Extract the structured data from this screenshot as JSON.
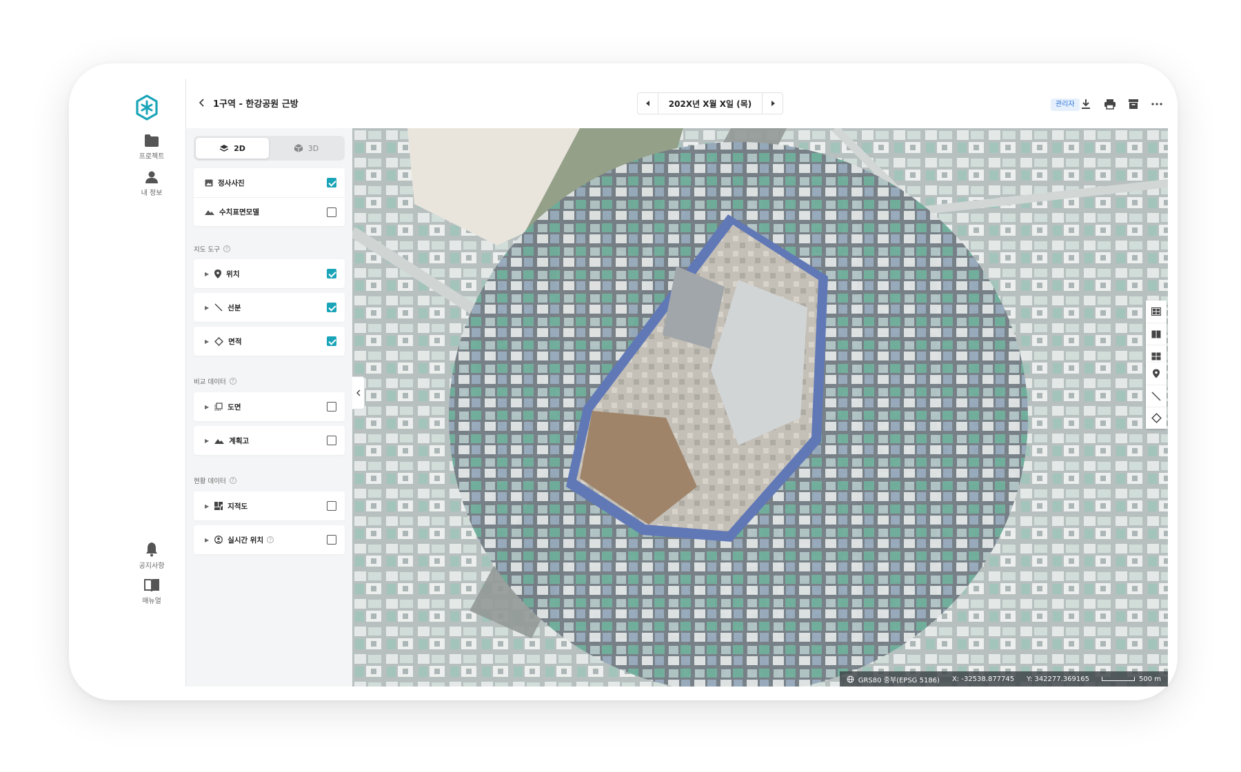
{
  "app": {
    "accent": "#1aa4b8"
  },
  "rail": {
    "items": [
      {
        "label": "프로젝트",
        "icon": "folder-icon"
      },
      {
        "label": "내 정보",
        "icon": "user-icon"
      }
    ],
    "bottom": [
      {
        "label": "공지사항",
        "icon": "bell-icon"
      },
      {
        "label": "매뉴얼",
        "icon": "book-icon"
      }
    ]
  },
  "header": {
    "title": "1구역 - 한강공원 근방",
    "date": "202X년 X월 X일 (목)",
    "role_badge": "관리자"
  },
  "panel": {
    "view_tabs": [
      {
        "label": "2D",
        "active": true
      },
      {
        "label": "3D",
        "active": false
      }
    ],
    "base_layers": [
      {
        "label": "정사사진",
        "checked": true,
        "icon": "image-icon"
      },
      {
        "label": "수치표면모델",
        "checked": false,
        "icon": "terrain-icon"
      }
    ],
    "map_tools": {
      "title": "지도 도구",
      "items": [
        {
          "label": "위치",
          "checked": true,
          "icon": "pin-icon"
        },
        {
          "label": "선분",
          "checked": true,
          "icon": "line-icon"
        },
        {
          "label": "면적",
          "checked": true,
          "icon": "diamond-icon"
        }
      ]
    },
    "compare_data": {
      "title": "비교 데이터",
      "items": [
        {
          "label": "도면",
          "checked": false,
          "icon": "drawing-icon"
        },
        {
          "label": "계획고",
          "checked": false,
          "icon": "terrain-icon"
        }
      ]
    },
    "current_data": {
      "title": "현황 데이터",
      "items": [
        {
          "label": "지적도",
          "checked": false,
          "icon": "cadastral-icon"
        },
        {
          "label": "실시간 위치",
          "checked": false,
          "icon": "person-location-icon"
        }
      ]
    }
  },
  "map": {
    "crs": "GRS80 중부(EPSG 5186)",
    "x": "X: -32538.877745",
    "y": "Y: 342277.369165",
    "scale": "500 m"
  }
}
